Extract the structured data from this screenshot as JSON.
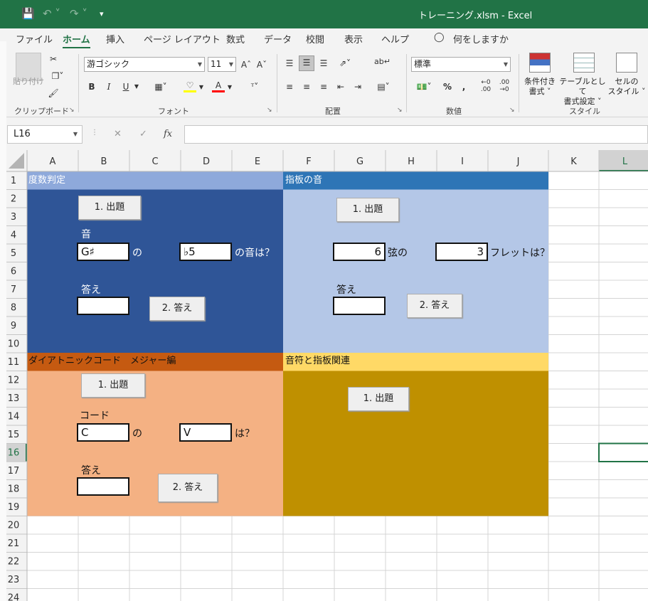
{
  "window": {
    "title": "トレーニング.xlsm  -  Excel"
  },
  "menu": [
    "ファイル",
    "ホーム",
    "挿入",
    "ページ レイアウト",
    "数式",
    "データ",
    "校閲",
    "表示",
    "ヘルプ"
  ],
  "tell_me": "何をしますか",
  "ribbon": {
    "clipboard": {
      "label": "クリップボード",
      "paste": "貼り付け"
    },
    "font": {
      "label": "フォント",
      "family": "游ゴシック",
      "size": "11",
      "bold": "B",
      "italic": "I",
      "underline": "U"
    },
    "alignment": {
      "label": "配置"
    },
    "number": {
      "label": "数値",
      "format": "標準"
    },
    "styles": {
      "label": "スタイル",
      "conditional_l1": "条件付き",
      "conditional_l2": "書式",
      "table_l1": "テーブルとして",
      "table_l2": "書式設定",
      "cell_l1": "セルの",
      "cell_l2": "スタイル"
    }
  },
  "formula_bar": {
    "name_box": "L16",
    "formula": ""
  },
  "columns": [
    "A",
    "B",
    "C",
    "D",
    "E",
    "F",
    "G",
    "H",
    "I",
    "J",
    "K",
    "L"
  ],
  "rows": [
    "1",
    "2",
    "3",
    "4",
    "5",
    "6",
    "7",
    "8",
    "9",
    "10",
    "11",
    "12",
    "13",
    "14",
    "15",
    "16",
    "17",
    "18",
    "19",
    "20",
    "21",
    "22",
    "23",
    "24"
  ],
  "selected_cell": "L16",
  "colors": {
    "excel_green": "#217346",
    "panel1_header": "#8ea9db",
    "panel1_body": "#2f5597",
    "panel2_header": "#2e75b6",
    "panel2_body": "#b4c7e7",
    "panel3_header": "#c55a11",
    "panel3_body": "#f4b183",
    "panel4_header": "#ffd966",
    "panel4_body": "#bf9000"
  },
  "panels": {
    "p1": {
      "title": "度数判定",
      "btn_question": "1. 出題",
      "label_note": "音",
      "value_note": "G♯",
      "text_no": "の",
      "value_interval": "♭5",
      "text_question": "の音は？",
      "label_answer": "答え",
      "value_answer": "",
      "btn_answer": "2. 答え"
    },
    "p2": {
      "title": "指板の音",
      "btn_question": "1. 出題",
      "value_string": "6",
      "text_string": "弦の",
      "value_fret": "3",
      "text_fret": "フレットは？",
      "label_answer": "答え",
      "value_answer": "",
      "btn_answer": "2. 答え"
    },
    "p3": {
      "title": "ダイアトニックコード　メジャー編",
      "btn_question": "1. 出題",
      "label_chord": "コード",
      "value_key": "C",
      "text_no": "の",
      "value_degree": "V",
      "text_question": "は？",
      "label_answer": "答え",
      "value_answer": "",
      "btn_answer": "2. 答え"
    },
    "p4": {
      "title": "音符と指板関連",
      "btn_question": "1. 出題"
    }
  }
}
